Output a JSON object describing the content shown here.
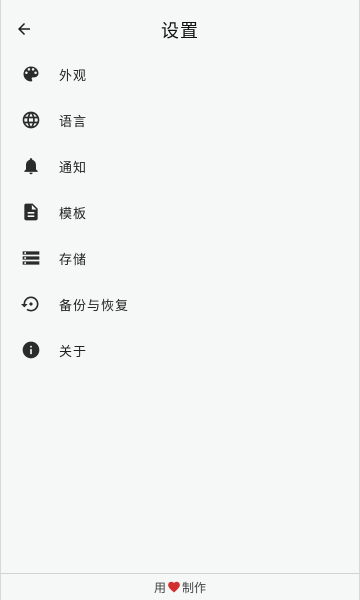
{
  "header": {
    "title": "设置",
    "back_icon": "arrow-left-icon"
  },
  "menu": {
    "items": [
      {
        "label": "外观",
        "icon": "palette-icon"
      },
      {
        "label": "语言",
        "icon": "globe-icon"
      },
      {
        "label": "通知",
        "icon": "bell-icon"
      },
      {
        "label": "模板",
        "icon": "document-icon"
      },
      {
        "label": "存储",
        "icon": "storage-icon"
      },
      {
        "label": "备份与恢复",
        "icon": "restore-icon"
      },
      {
        "label": "关于",
        "icon": "info-icon"
      }
    ]
  },
  "footer": {
    "prefix": "用",
    "suffix": "制作",
    "heart_icon": "heart-icon",
    "heart_color": "#d32f2f"
  },
  "colors": {
    "background": "#f5f8f7",
    "icon": "#2b2b2b"
  }
}
